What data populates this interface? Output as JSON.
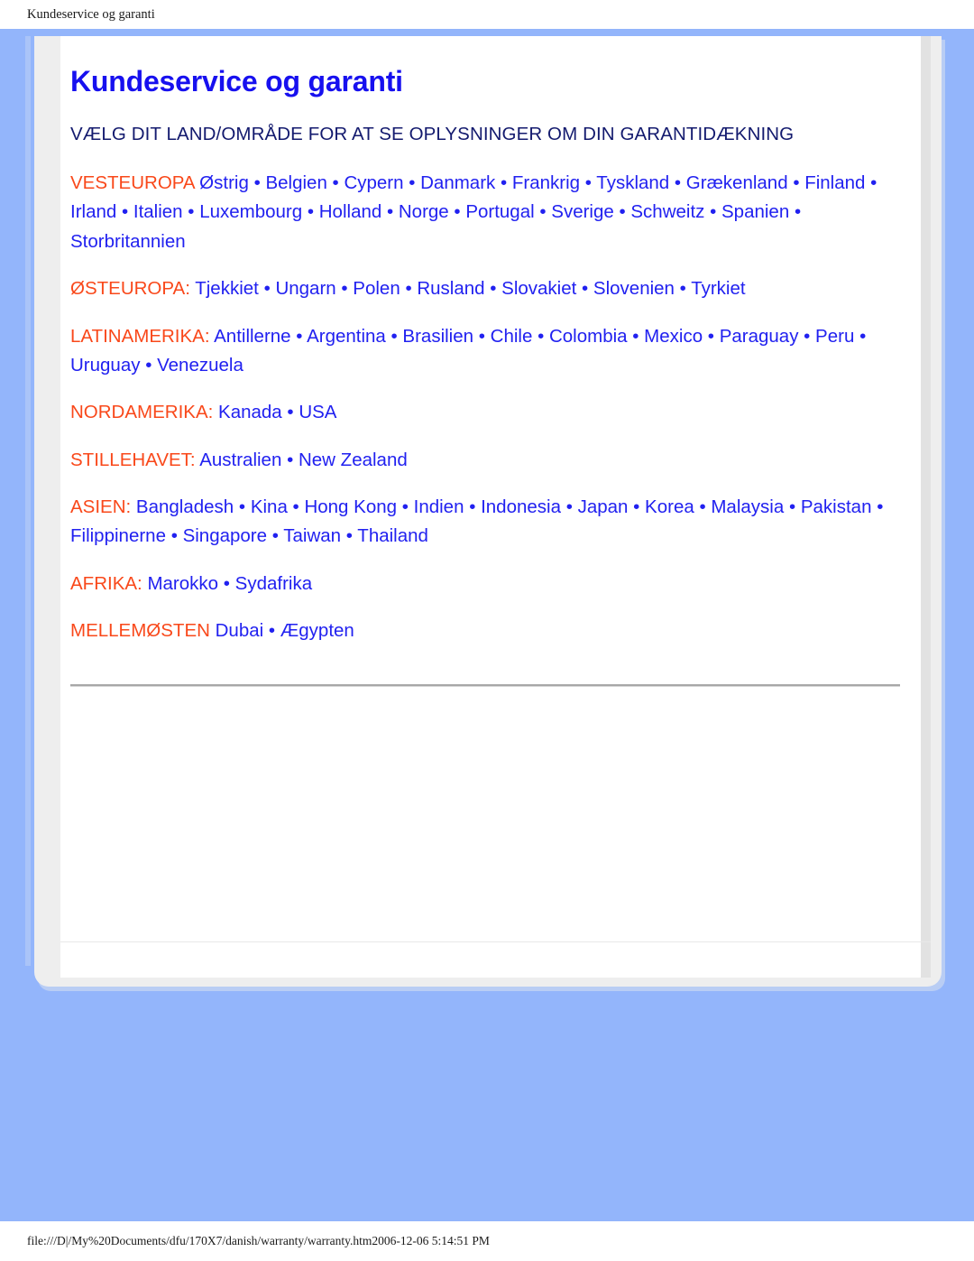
{
  "print_header": "Kundeservice og garanti",
  "print_footer": "file:///D|/My%20Documents/dfu/170X7/danish/warranty/warranty.htm2006-12-06 5:14:51 PM",
  "page": {
    "title": "Kundeservice og garanti",
    "section_heading": "VÆLG DIT LAND/OMRÅDE FOR AT SE OPLYSNINGER OM DIN GARANTIDÆKNING"
  },
  "colors": {
    "page_background": "#93b5fb",
    "title_blue": "#1710ef",
    "link_blue": "#2121f0",
    "region_label_orange": "#f9481a",
    "heading_navy": "#131a6e",
    "sheet_white": "#ffffff",
    "card_grey": "#eeeeee"
  },
  "separator": "•",
  "regions": [
    {
      "label": "VESTEUROPA",
      "countries": [
        "Østrig",
        "Belgien",
        "Cypern",
        "Danmark",
        "Frankrig",
        "Tyskland",
        "Grækenland",
        "Finland",
        "Irland",
        "Italien",
        "Luxembourg",
        "Holland",
        "Norge",
        "Portugal",
        "Sverige",
        "Schweitz",
        "Spanien",
        "Storbritannien"
      ]
    },
    {
      "label": "ØSTEUROPA:",
      "countries": [
        "Tjekkiet",
        "Ungarn",
        "Polen",
        "Rusland",
        "Slovakiet",
        "Slovenien",
        "Tyrkiet"
      ]
    },
    {
      "label": "LATINAMERIKA:",
      "countries": [
        "Antillerne",
        "Argentina",
        "Brasilien",
        "Chile",
        "Colombia",
        "Mexico",
        "Paraguay",
        "Peru",
        "Uruguay",
        "Venezuela"
      ]
    },
    {
      "label": "NORDAMERIKA:",
      "countries": [
        "Kanada",
        "USA"
      ]
    },
    {
      "label": "STILLEHAVET:",
      "countries": [
        "Australien",
        "New Zealand"
      ]
    },
    {
      "label": "ASIEN:",
      "countries": [
        "Bangladesh",
        "Kina",
        "Hong Kong",
        "Indien",
        "Indonesia",
        "Japan",
        "Korea",
        "Malaysia",
        "Pakistan",
        "Filippinerne",
        "Singapore",
        "Taiwan",
        "Thailand"
      ]
    },
    {
      "label": "AFRIKA:",
      "countries": [
        "Marokko",
        "Sydafrika"
      ]
    },
    {
      "label": "MELLEMØSTEN",
      "countries": [
        "Dubai",
        "Ægypten"
      ]
    }
  ]
}
